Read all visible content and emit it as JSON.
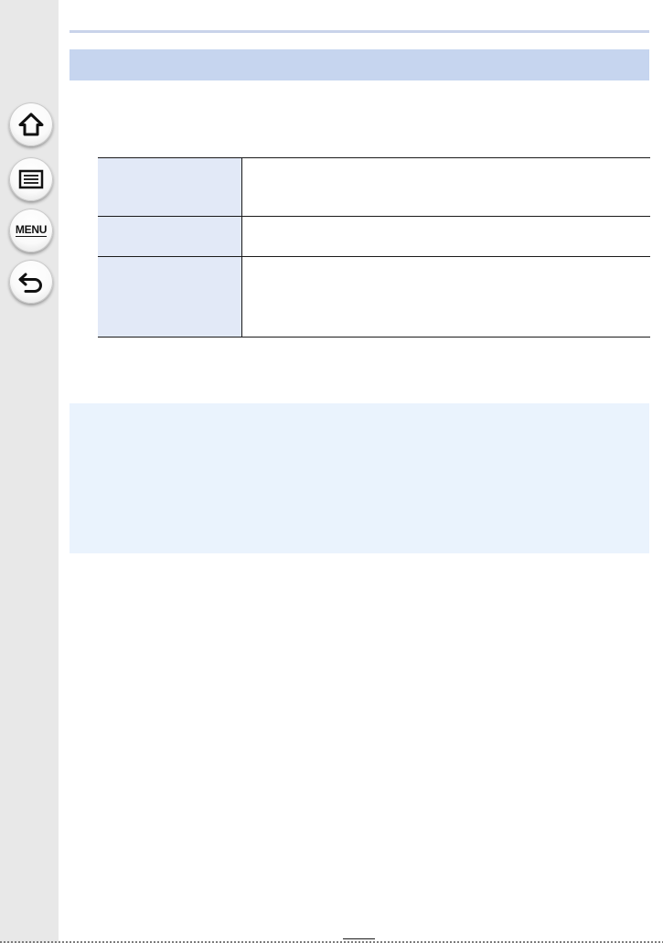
{
  "sidebar": {
    "buttons": [
      {
        "name": "home",
        "icon": "home-icon"
      },
      {
        "name": "contents",
        "icon": "list-icon"
      },
      {
        "name": "menu",
        "icon": "menu-icon",
        "label": "MENU"
      },
      {
        "name": "back",
        "icon": "back-arrow-icon"
      }
    ]
  },
  "page": {
    "heading": "",
    "intro": "",
    "table": [
      {
        "key": "",
        "value": ""
      },
      {
        "key": "",
        "value": ""
      },
      {
        "key": "",
        "value": ""
      }
    ],
    "note": "",
    "page_number": ""
  },
  "colors": {
    "sidebar_bg": "#e8e8e8",
    "heading_band": "#c6d5ef",
    "table_key_bg": "#e2e9f7",
    "note_bg": "#eaf3fd",
    "top_rule": "#c9d3ea"
  }
}
